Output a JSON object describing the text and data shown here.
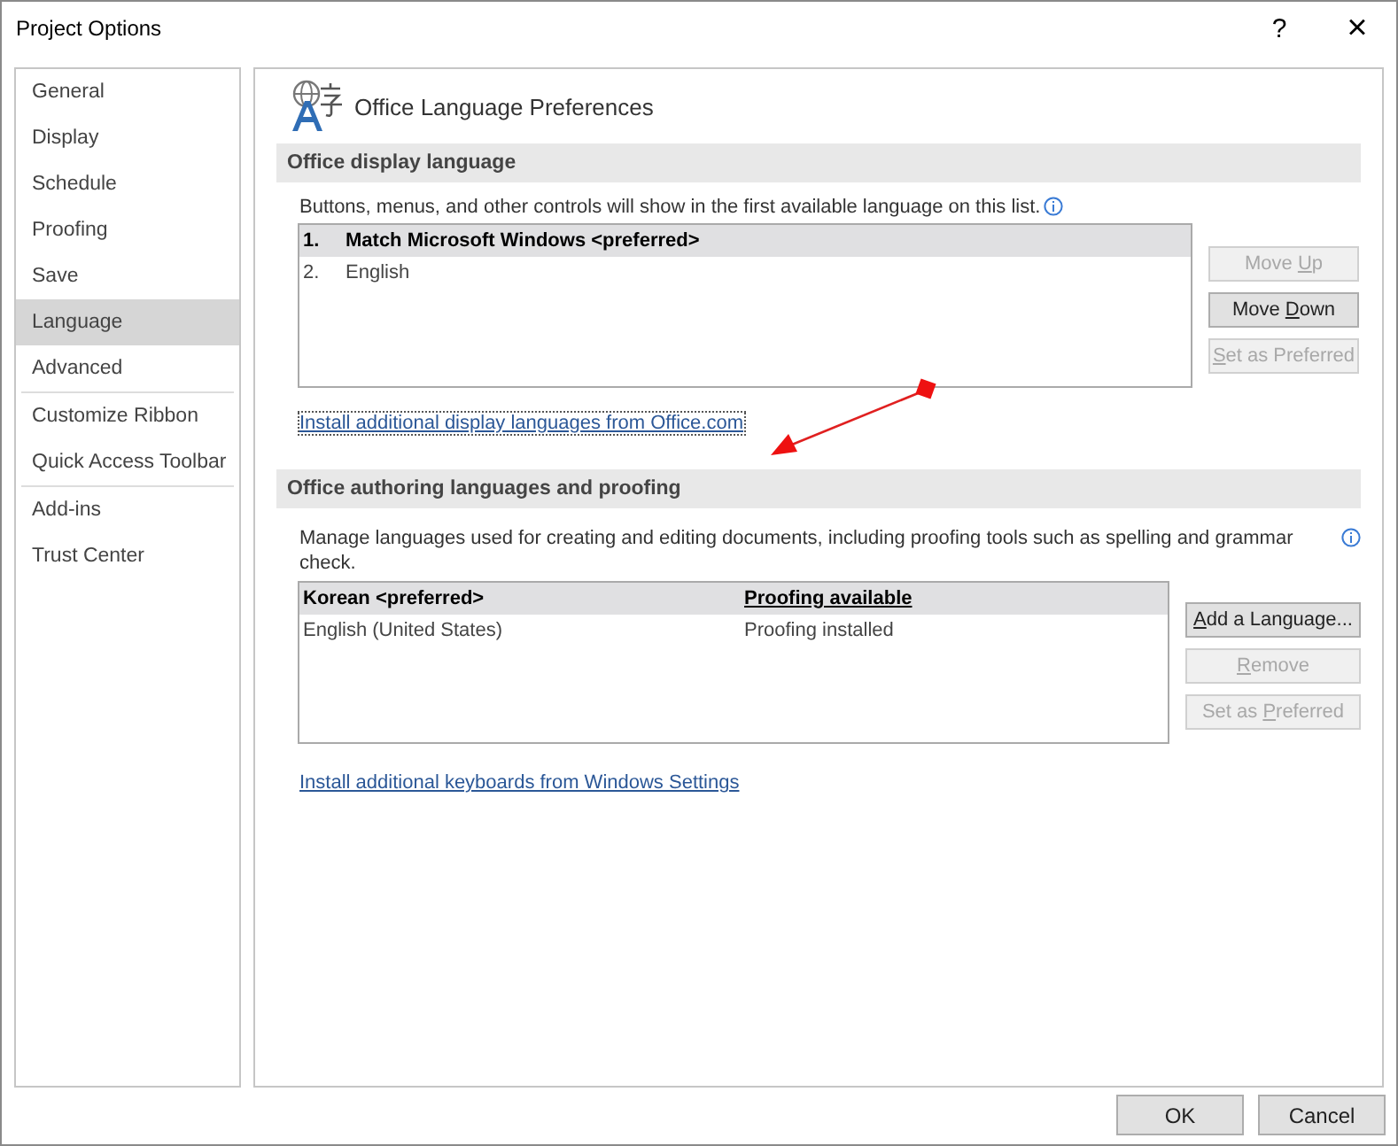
{
  "window": {
    "title": "Project Options",
    "help": "?",
    "close": "×"
  },
  "sidebar": {
    "groups": [
      [
        {
          "label": "General",
          "selected": false
        },
        {
          "label": "Display",
          "selected": false
        },
        {
          "label": "Schedule",
          "selected": false
        },
        {
          "label": "Proofing",
          "selected": false
        },
        {
          "label": "Save",
          "selected": false
        },
        {
          "label": "Language",
          "selected": true
        },
        {
          "label": "Advanced",
          "selected": false
        }
      ],
      [
        {
          "label": "Customize Ribbon",
          "selected": false
        },
        {
          "label": "Quick Access Toolbar",
          "selected": false
        }
      ],
      [
        {
          "label": "Add-ins",
          "selected": false
        },
        {
          "label": "Trust Center",
          "selected": false
        }
      ]
    ]
  },
  "page_title": "Office Language Preferences",
  "display_language": {
    "heading": "Office display language",
    "description": "Buttons, menus, and other controls will show in the first available language on this list.",
    "rows": [
      {
        "number": "1.",
        "name": "Match Microsoft Windows <preferred>",
        "selected": true
      },
      {
        "number": "2.",
        "name": "English",
        "selected": false
      }
    ],
    "buttons": [
      {
        "label": [
          {
            "text": "Move ",
            "underlined": false
          },
          {
            "text": "U",
            "underlined": true
          },
          {
            "text": "p",
            "underlined": false
          }
        ],
        "disabled": true
      },
      {
        "label": [
          {
            "text": "Move ",
            "underlined": false
          },
          {
            "text": "D",
            "underlined": true
          },
          {
            "text": "own",
            "underlined": false
          }
        ],
        "disabled": false
      },
      {
        "label": [
          {
            "text": "S",
            "underlined": true
          },
          {
            "text": "et as Preferred",
            "underlined": false
          }
        ],
        "disabled": true
      }
    ],
    "link": "Install additional display languages from Office.com"
  },
  "authoring": {
    "heading": "Office authoring languages and proofing",
    "description": "Manage languages used for creating and editing documents, including proofing tools such as spelling and grammar check.",
    "rows": [
      {
        "name": "Korean <preferred>",
        "status": "Proofing available",
        "selected": true
      },
      {
        "name": "English (United States)",
        "status": "Proofing installed",
        "selected": false
      }
    ],
    "buttons": [
      {
        "label": [
          {
            "text": "A",
            "underlined": true
          },
          {
            "text": "dd a Language...",
            "underlined": false
          }
        ],
        "disabled": false
      },
      {
        "label": [
          {
            "text": "R",
            "underlined": true
          },
          {
            "text": "emove",
            "underlined": false
          }
        ],
        "disabled": true
      },
      {
        "label": [
          {
            "text": "Set as ",
            "underlined": false
          },
          {
            "text": "P",
            "underlined": true
          },
          {
            "text": "referred",
            "underlined": false
          }
        ],
        "disabled": true
      }
    ],
    "link": "Install additional keyboards from Windows Settings"
  },
  "footer": {
    "buttons": [
      "OK",
      "Cancel"
    ]
  }
}
